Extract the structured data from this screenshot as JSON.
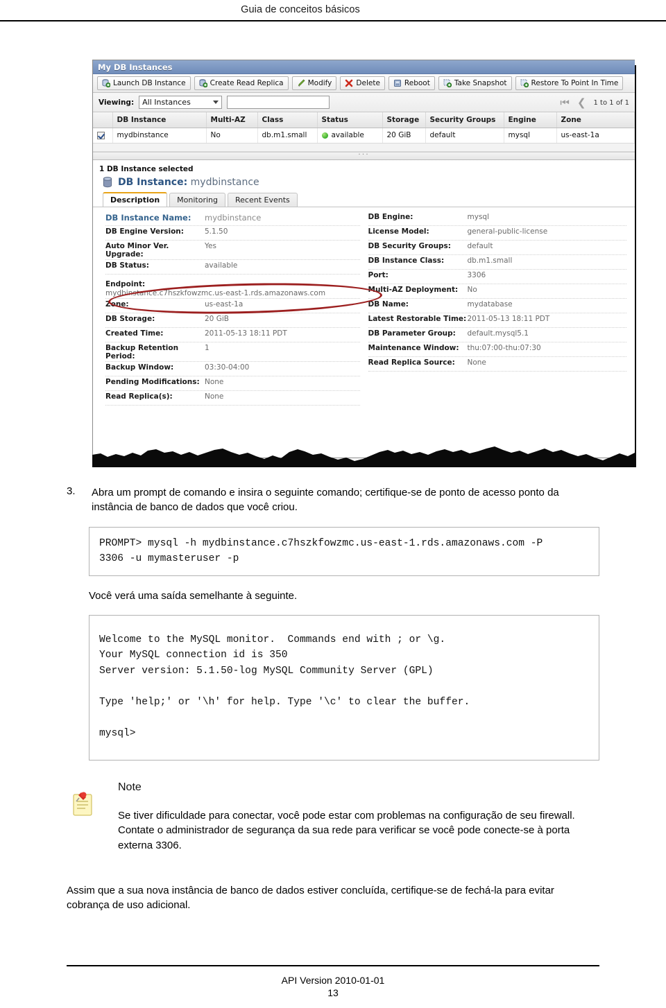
{
  "page": {
    "header_title": "Guia de conceitos básicos",
    "footer_api_version": "API Version 2010-01-01",
    "footer_page_number": "13"
  },
  "console": {
    "window_title": "My DB Instances",
    "toolbar": [
      {
        "label": "Launch DB Instance",
        "icon": "launch-db-instance-icon"
      },
      {
        "label": "Create Read Replica",
        "icon": "create-read-replica-icon"
      },
      {
        "label": "Modify",
        "icon": "modify-pencil-icon"
      },
      {
        "label": "Delete",
        "icon": "delete-x-icon"
      },
      {
        "label": "Reboot",
        "icon": "reboot-icon"
      },
      {
        "label": "Take Snapshot",
        "icon": "take-snapshot-icon"
      },
      {
        "label": "Restore To Point In Time",
        "icon": "restore-point-in-time-icon"
      }
    ],
    "viewing": {
      "label": "Viewing:",
      "selected": "All Instances",
      "filter_value": "",
      "filter_placeholder": ""
    },
    "pagination": {
      "text": "1 to 1 of 1"
    },
    "grid": {
      "columns": [
        "",
        "DB Instance",
        "Multi-AZ",
        "Class",
        "Status",
        "Storage",
        "Security Groups",
        "Engine",
        "Zone"
      ],
      "rows": [
        {
          "checked": true,
          "db_instance": "mydbinstance",
          "multi_az": "No",
          "class": "db.m1.small",
          "status": "available",
          "storage": "20 GiB",
          "security_groups": "default",
          "engine": "mysql",
          "zone": "us-east-1a"
        }
      ]
    },
    "details": {
      "selection_text": "1 DB Instance selected",
      "heading_label": "DB Instance:",
      "heading_value": "mydbinstance",
      "tabs": [
        {
          "label": "Description",
          "active": true
        },
        {
          "label": "Monitoring",
          "active": false
        },
        {
          "label": "Recent Events",
          "active": false
        }
      ],
      "left_fields": [
        {
          "key": "DB Instance Name:",
          "value": "mydbinstance"
        },
        {
          "key": "DB Engine Version:",
          "value": "5.1.50"
        },
        {
          "key": "Auto Minor Ver. Upgrade:",
          "value": "Yes"
        },
        {
          "key": "DB Status:",
          "value": "available"
        },
        {
          "key": "Endpoint:",
          "value": "mydbinstance.c7hszkfowzmc.us-east-1.rds.amazonaws.com"
        },
        {
          "key": "Zone:",
          "value": "us-east-1a"
        },
        {
          "key": "DB Storage:",
          "value": "20 GiB"
        },
        {
          "key": "Created Time:",
          "value": "2011-05-13 18:11 PDT"
        },
        {
          "key": "Backup Retention Period:",
          "value": "1"
        },
        {
          "key": "Backup Window:",
          "value": "03:30-04:00"
        },
        {
          "key": "Pending Modifications:",
          "value": "None"
        },
        {
          "key": "Read Replica(s):",
          "value": "None"
        }
      ],
      "right_fields": [
        {
          "key": "DB Engine:",
          "value": "mysql"
        },
        {
          "key": "License Model:",
          "value": "general-public-license"
        },
        {
          "key": "DB Security Groups:",
          "value": "default"
        },
        {
          "key": "DB Instance Class:",
          "value": "db.m1.small"
        },
        {
          "key": "Port:",
          "value": "3306"
        },
        {
          "key": "Multi-AZ Deployment:",
          "value": "No"
        },
        {
          "key": "DB Name:",
          "value": "mydatabase"
        },
        {
          "key": "Latest Restorable Time:",
          "value": "2011-05-13 18:11 PDT"
        },
        {
          "key": "DB Parameter Group:",
          "value": "default.mysql5.1"
        },
        {
          "key": "Maintenance Window:",
          "value": "thu:07:00-thu:07:30"
        },
        {
          "key": "Read Replica Source:",
          "value": "None"
        }
      ],
      "annotation_color": "#9c1f1f"
    }
  },
  "doc": {
    "step_number": "3.",
    "step_text": "Abra um prompt de comando e insira o seguinte comando; certifique-se de ponto de acesso ponto da instância de banco de dados que você criou.",
    "command_block": "PROMPT> mysql -h mydbinstance.c7hszkfowzmc.us-east-1.rds.amazonaws.com -P\n3306 -u mymasteruser -p",
    "output_intro": "Você verá uma saída semelhante à seguinte.",
    "output_block": "Welcome to the MySQL monitor.  Commands end with ; or \\g.\nYour MySQL connection id is 350\nServer version: 5.1.50-log MySQL Community Server (GPL)\n\nType 'help;' or '\\h' for help. Type '\\c' to clear the buffer.\n\nmysql>",
    "note_title": "Note",
    "note_body": "Se tiver dificuldade para conectar, você pode estar com problemas na configuração de seu firewall. Contate o administrador de segurança da sua rede para verificar se você pode conecte-se à porta externa 3306.",
    "closing_text": "Assim que a sua nova instância de banco de dados estiver concluída, certifique-se de fechá-la para evitar cobrança de uso adicional."
  }
}
